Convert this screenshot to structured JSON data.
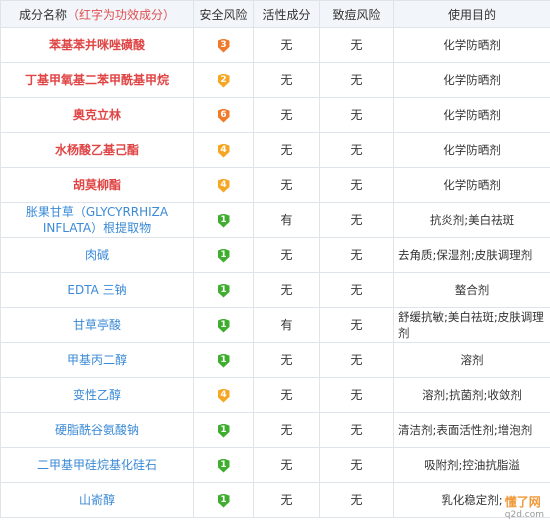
{
  "headers": {
    "name": "成分名称",
    "name_note": "（红字为功效成分）",
    "safety": "安全风险",
    "active": "活性成分",
    "acne": "致痘风险",
    "purpose": "使用目的"
  },
  "rows": [
    {
      "name": "苯基苯并咪唑磺酸",
      "red": true,
      "safety": "3",
      "active": "无",
      "acne": "无",
      "purpose": "化学防晒剂"
    },
    {
      "name": "丁基甲氧基二苯甲酰基甲烷",
      "red": true,
      "safety": "2",
      "active": "无",
      "acne": "无",
      "purpose": "化学防晒剂"
    },
    {
      "name": "奥克立林",
      "red": true,
      "safety": "6",
      "active": "无",
      "acne": "无",
      "purpose": "化学防晒剂"
    },
    {
      "name": "水杨酸乙基己酯",
      "red": true,
      "safety": "4",
      "active": "无",
      "acne": "无",
      "purpose": "化学防晒剂"
    },
    {
      "name": "胡莫柳酯",
      "red": true,
      "safety": "4",
      "active": "无",
      "acne": "无",
      "purpose": "化学防晒剂"
    },
    {
      "name": "胀果甘草（GLYCYRRHIZA INFLATA）根提取物",
      "red": false,
      "safety": "1",
      "active": "有",
      "acne": "无",
      "purpose": "抗炎剂;美白祛斑"
    },
    {
      "name": "肉碱",
      "red": false,
      "safety": "1",
      "active": "无",
      "acne": "无",
      "purpose": "去角质;保湿剂;皮肤调理剂"
    },
    {
      "name": "EDTA 三钠",
      "red": false,
      "safety": "1",
      "active": "无",
      "acne": "无",
      "purpose": "螯合剂"
    },
    {
      "name": "甘草亭酸",
      "red": false,
      "safety": "1",
      "active": "有",
      "acne": "无",
      "purpose": "舒缓抗敏;美白祛斑;皮肤调理剂"
    },
    {
      "name": "甲基丙二醇",
      "red": false,
      "safety": "1",
      "active": "无",
      "acne": "无",
      "purpose": "溶剂"
    },
    {
      "name": "变性乙醇",
      "red": false,
      "safety": "4",
      "active": "无",
      "acne": "无",
      "purpose": "溶剂;抗菌剂;收敛剂"
    },
    {
      "name": "硬脂酰谷氨酸钠",
      "red": false,
      "safety": "1",
      "active": "无",
      "acne": "无",
      "purpose": "清洁剂;表面活性剂;增泡剂"
    },
    {
      "name": "二甲基甲硅烷基化硅石",
      "red": false,
      "safety": "1",
      "active": "无",
      "acne": "无",
      "purpose": "吸附剂;控油抗脂溢"
    },
    {
      "name": "山嵛醇",
      "red": false,
      "safety": "1",
      "active": "无",
      "acne": "无",
      "purpose": "乳化稳定剂;"
    }
  ],
  "watermark": {
    "title": "懂了网",
    "domain": "q2d.com"
  }
}
